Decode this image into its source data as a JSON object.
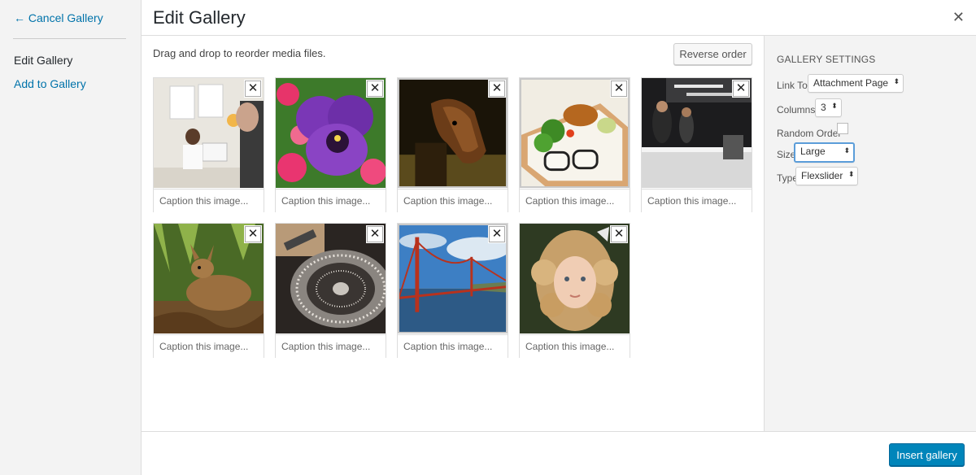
{
  "menu": {
    "cancel_label": "← Cancel Gallery",
    "items": [
      {
        "label": "Edit Gallery"
      },
      {
        "label": "Add to Gallery"
      }
    ]
  },
  "header": {
    "title": "Edit Gallery",
    "close_glyph": "✕"
  },
  "toolbar": {
    "instructions": "Drag and drop to reorder media files.",
    "reverse_label": "Reverse order"
  },
  "attachments": [
    {
      "caption_placeholder": "Caption this image...",
      "remove_glyph": "✕",
      "subject": "office meeting"
    },
    {
      "caption_placeholder": "Caption this image...",
      "remove_glyph": "✕",
      "subject": "purple pansy flower"
    },
    {
      "caption_placeholder": "Caption this image...",
      "remove_glyph": "✕",
      "subject": "horse head"
    },
    {
      "caption_placeholder": "Caption this image...",
      "remove_glyph": "✕",
      "subject": "bento lunch box"
    },
    {
      "caption_placeholder": "Caption this image...",
      "remove_glyph": "✕",
      "subject": "bar interior with people"
    },
    {
      "caption_placeholder": "Caption this image...",
      "remove_glyph": "✕",
      "subject": "deer in forest"
    },
    {
      "caption_placeholder": "Caption this image...",
      "remove_glyph": "✕",
      "subject": "dj turntable"
    },
    {
      "caption_placeholder": "Caption this image...",
      "remove_glyph": "✕",
      "subject": "golden gate bridge"
    },
    {
      "caption_placeholder": "Caption this image...",
      "remove_glyph": "✕",
      "subject": "curly haired girl"
    }
  ],
  "settings": {
    "heading": "Gallery Settings",
    "link_to": {
      "label": "Link To",
      "value": "Attachment Page"
    },
    "columns": {
      "label": "Columns",
      "value": "3"
    },
    "random_order": {
      "label": "Random Order",
      "checked": false
    },
    "size": {
      "label": "Size",
      "value": "Large"
    },
    "type": {
      "label": "Type",
      "value": "Flexslider"
    }
  },
  "footer": {
    "insert_label": "Insert gallery"
  },
  "colors": {
    "link": "#0073aa",
    "primary": "#0085ba",
    "focus": "#5b9dd9"
  }
}
